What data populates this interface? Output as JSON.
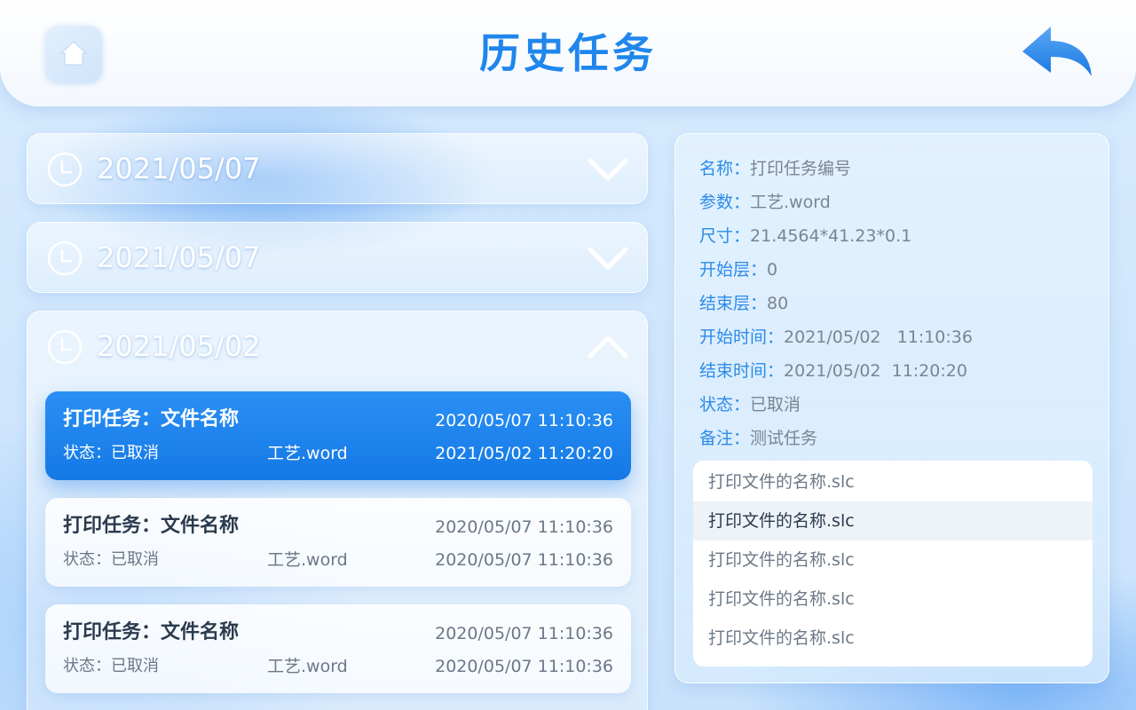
{
  "header": {
    "title": "历史任务",
    "home_icon": "home-icon",
    "back_icon": "back-arrow-icon"
  },
  "date_groups": [
    {
      "date": "2021/05/07",
      "expanded": false
    },
    {
      "date": "2021/05/07",
      "expanded": false
    },
    {
      "date": "2021/05/02",
      "expanded": true
    }
  ],
  "tasks": [
    {
      "title": "打印任务：文件名称",
      "time_start": "2020/05/07 11:10:36",
      "status": "状态：已取消",
      "craft": "工艺.word",
      "time_end": "2021/05/02 11:20:20",
      "selected": true
    },
    {
      "title": "打印任务：文件名称",
      "time_start": "2020/05/07 11:10:36",
      "status": "状态：已取消",
      "craft": "工艺.word",
      "time_end": "2020/05/07 11:10:36",
      "selected": false
    },
    {
      "title": "打印任务：文件名称",
      "time_start": "2020/05/07 11:10:36",
      "status": "状态：已取消",
      "craft": "工艺.word",
      "time_end": "2020/05/07 11:10:36",
      "selected": false
    }
  ],
  "detail": {
    "fields": [
      {
        "label": "名称：",
        "value": "打印任务编号"
      },
      {
        "label": "参数：",
        "value": "工艺.word"
      },
      {
        "label": "尺寸：",
        "value": "21.4564*41.23*0.1"
      },
      {
        "label": "开始层：",
        "value": "0"
      },
      {
        "label": "结束层：",
        "value": "80"
      },
      {
        "label": "开始时间：",
        "value": "2021/05/02   11:10:36"
      },
      {
        "label": "结束时间：",
        "value": "2021/05/02  11:20:20"
      },
      {
        "label": "状态：",
        "value": "已取消"
      },
      {
        "label": "备注：",
        "value": "测试任务"
      }
    ],
    "files": [
      "打印文件的名称.slc",
      "打印文件的名称.slc",
      "打印文件的名称.slc",
      "打印文件的名称.slc",
      "打印文件的名称.slc"
    ],
    "highlighted_file_index": 1
  },
  "colors": {
    "accent": "#1f86ec",
    "selected_card": "#1a82ee",
    "label_blue": "#2c8be9",
    "value_gray": "#7a8593"
  }
}
